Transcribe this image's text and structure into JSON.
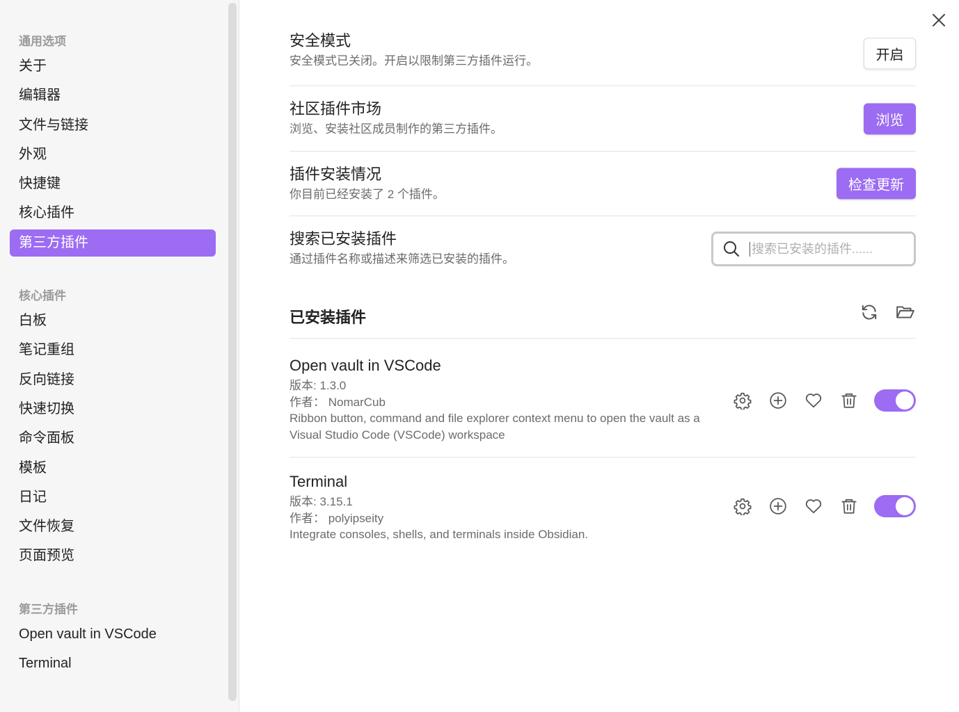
{
  "sidebar": {
    "sections": [
      {
        "header": "通用选项",
        "items": [
          "关于",
          "编辑器",
          "文件与链接",
          "外观",
          "快捷键",
          "核心插件",
          "第三方插件"
        ],
        "active_index": 6
      },
      {
        "header": "核心插件",
        "items": [
          "白板",
          "笔记重组",
          "反向链接",
          "快速切换",
          "命令面板",
          "模板",
          "日记",
          "文件恢复",
          "页面预览"
        ]
      },
      {
        "header": "第三方插件",
        "items": [
          "Open vault in VSCode",
          "Terminal"
        ]
      }
    ]
  },
  "settings": {
    "safe_mode": {
      "name": "安全模式",
      "desc": "安全模式已关闭。开启以限制第三方插件运行。",
      "button": "开启"
    },
    "community": {
      "name": "社区插件市场",
      "desc": "浏览、安装社区成员制作的第三方插件。",
      "button": "浏览"
    },
    "status": {
      "name": "插件安装情况",
      "desc": "你目前已经安装了 2 个插件。",
      "button": "检查更新"
    },
    "search": {
      "name": "搜索已安装插件",
      "desc": "通过插件名称或描述来筛选已安装的插件。",
      "placeholder": "搜索已安装的插件......",
      "value": ""
    }
  },
  "installed": {
    "title": "已安装插件",
    "plugins": [
      {
        "name": "Open vault in VSCode",
        "version": "版本: 1.3.0",
        "author": "作者：  NomarCub",
        "desc": "Ribbon button, command and file explorer context menu to open the vault as a Visual Studio Code (VSCode) workspace",
        "enabled": true
      },
      {
        "name": "Terminal",
        "version": "版本: 3.15.1",
        "author": "作者：  polyipseity",
        "desc": "Integrate consoles, shells, and terminals inside Obsidian.",
        "enabled": true
      }
    ]
  },
  "icons": {
    "close": "close-icon",
    "search": "search-icon",
    "reload": "reload-icon",
    "folder": "folder-open-icon",
    "settings": "gear-icon",
    "hotkey": "plus-circle-icon",
    "heart": "heart-icon",
    "delete": "trash-icon"
  },
  "colors": {
    "accent": "#9c6cf3",
    "sidebar_bg": "#f6f6f6",
    "muted_text": "#6b6b6b"
  }
}
